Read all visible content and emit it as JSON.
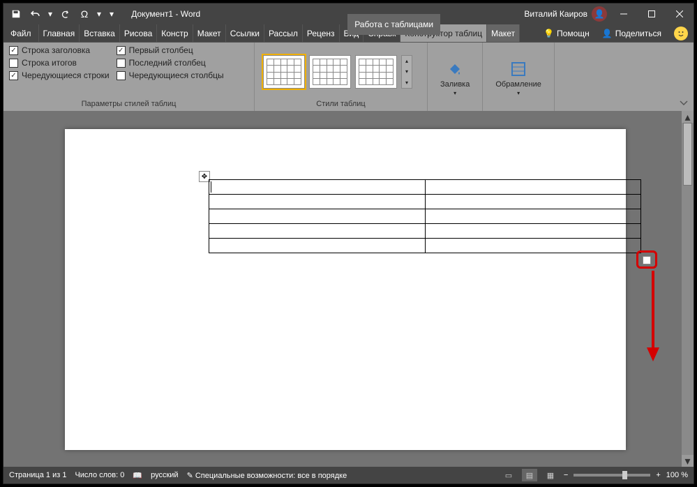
{
  "title": {
    "doc": "Документ1  -  Word",
    "context": "Работа с таблицами"
  },
  "user": {
    "name": "Виталий Каиров"
  },
  "tabs": {
    "file": "Файл",
    "items": [
      "Главная",
      "Вставка",
      "Рисова",
      "Констр",
      "Макет",
      "Ссылки",
      "Рассыл",
      "Реценз",
      "Вид",
      "Справк"
    ],
    "context_tabs": [
      "Конструктор таблиц",
      "Макет"
    ],
    "tell_me": "Помощн",
    "share": "Поделиться"
  },
  "ribbon": {
    "group1_label": "Параметры стилей таблиц",
    "group2_label": "Стили таблиц",
    "opts": {
      "header_row": "Строка заголовка",
      "total_row": "Строка итогов",
      "banded_rows": "Чередующиеся строки",
      "first_col": "Первый столбец",
      "last_col": "Последний столбец",
      "banded_cols": "Чередующиеся столбцы"
    },
    "shading": "Заливка",
    "borders": "Обрамление"
  },
  "status": {
    "page": "Страница 1 из 1",
    "words": "Число слов: 0",
    "lang": "русский",
    "a11y": "Специальные возможности: все в порядке",
    "zoom": "100 %"
  }
}
